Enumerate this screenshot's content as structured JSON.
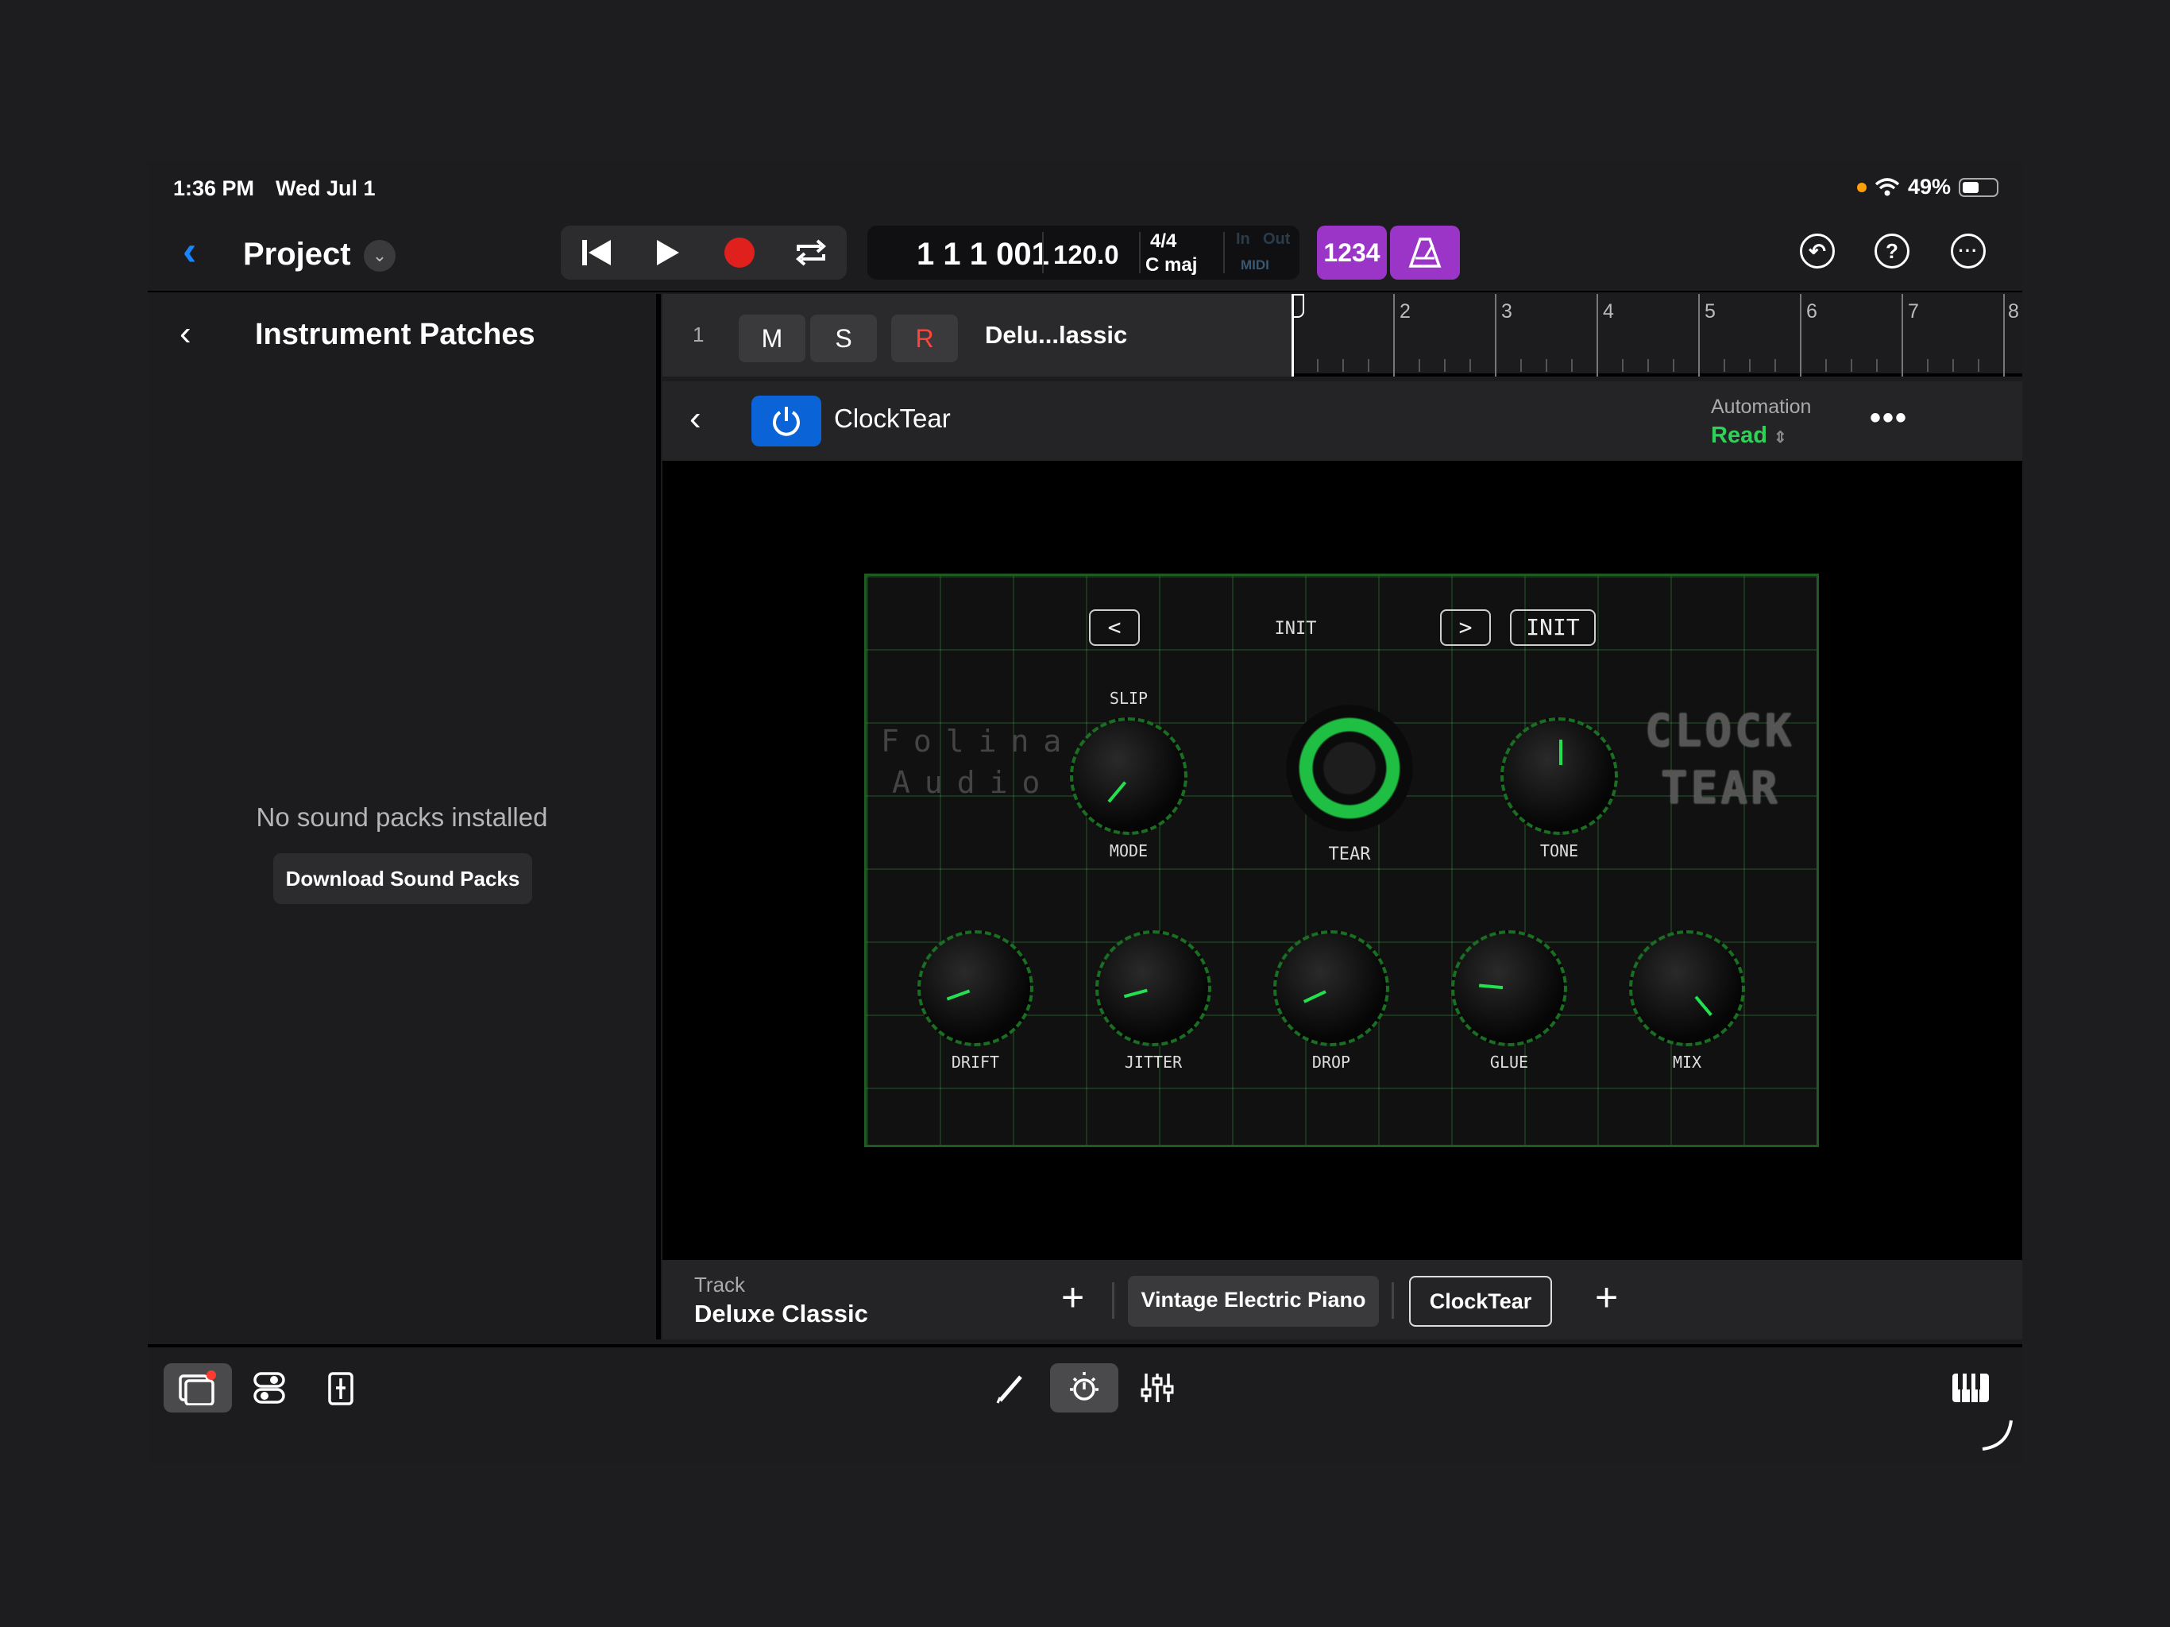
{
  "status": {
    "time": "1:36 PM",
    "date": "Wed Jul 1",
    "battery": "49%"
  },
  "header": {
    "project": "Project",
    "lcd": {
      "position": "1 1 1 001",
      "tempo": "120.0",
      "signature": "4/4",
      "key": "C maj",
      "midi": "MIDI",
      "in": "In",
      "out": "Out"
    },
    "count_in": "1234"
  },
  "sidebar": {
    "title": "Instrument Patches",
    "empty_message": "No sound packs installed",
    "download_label": "Download Sound Packs"
  },
  "track": {
    "number": "1",
    "mute": "M",
    "solo": "S",
    "record": "R",
    "name": "Delu...lassic"
  },
  "ruler": {
    "bars": [
      "2",
      "3",
      "4",
      "5",
      "6",
      "7",
      "8"
    ]
  },
  "plugin_header": {
    "name": "ClockTear",
    "automation_label": "Automation",
    "automation_mode": "Read"
  },
  "plugin": {
    "prev": "<",
    "next": ">",
    "preset": "INIT",
    "init_button": "INIT",
    "brand_line1": "Folina",
    "brand_line2": "Audio",
    "title_line1": "CLOCK",
    "title_line2": "TEAR",
    "knobs": {
      "slip_label": "SLIP",
      "mode": "MODE",
      "tear": "TEAR",
      "tone": "TONE",
      "drift": "DRIFT",
      "jitter": "JITTER",
      "drop": "DROP",
      "glue": "GLUE",
      "mix": "MIX"
    }
  },
  "bottom": {
    "track_label": "Track",
    "track_name": "Deluxe Classic",
    "slot1": "Vintage Electric Piano",
    "slot2": "ClockTear"
  },
  "colors": {
    "accent_blue": "#1a84ff",
    "power_blue": "#0a64d8",
    "purple": "#9b35c8",
    "read_green": "#30d158",
    "knob_green": "#22e050"
  }
}
